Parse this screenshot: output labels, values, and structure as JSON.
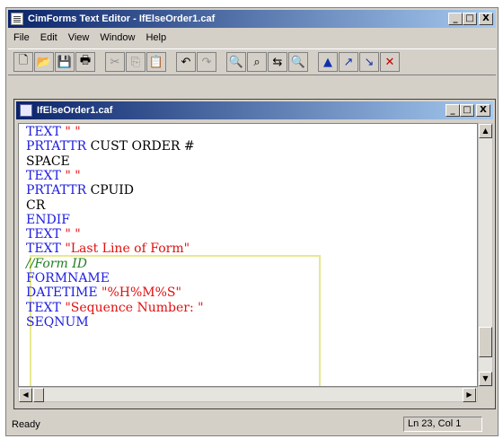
{
  "window": {
    "title": "CimForms Text Editor - IfElseOrder1.caf",
    "minimize_glyph": "_",
    "maximize_glyph": "□",
    "close_glyph": "X"
  },
  "menu": [
    {
      "label": "File"
    },
    {
      "label": "Edit"
    },
    {
      "label": "View"
    },
    {
      "label": "Window"
    },
    {
      "label": "Help"
    }
  ],
  "toolbar": [
    {
      "name": "new-icon",
      "glyph": "🗋"
    },
    {
      "name": "open-icon",
      "glyph": "📂"
    },
    {
      "name": "save-icon",
      "glyph": "💾"
    },
    {
      "name": "print-icon",
      "glyph": "🖶"
    },
    {
      "name": "cut-icon",
      "glyph": "✂"
    },
    {
      "name": "copy-icon",
      "glyph": "⎘"
    },
    {
      "name": "paste-icon",
      "glyph": "📋"
    },
    {
      "name": "undo-icon",
      "glyph": "↶"
    },
    {
      "name": "redo-icon",
      "glyph": "↷"
    },
    {
      "name": "find-icon",
      "glyph": "🔍"
    },
    {
      "name": "find-next-icon",
      "glyph": "⌕"
    },
    {
      "name": "replace-icon",
      "glyph": "⇆"
    },
    {
      "name": "find-red-icon",
      "glyph": "🔍"
    },
    {
      "name": "bookmark-icon",
      "glyph": "▲"
    },
    {
      "name": "bookmark-next-icon",
      "glyph": "↗"
    },
    {
      "name": "bookmark-prev-icon",
      "glyph": "↘"
    },
    {
      "name": "bookmark-clear-icon",
      "glyph": "✕"
    }
  ],
  "document": {
    "title": "IfElseOrder1.caf",
    "lines": [
      [
        {
          "c": "kw",
          "t": "TEXT "
        },
        {
          "c": "str",
          "t": "\" \""
        }
      ],
      [
        {
          "c": "kw",
          "t": "PRTATTR "
        },
        {
          "c": "plain",
          "t": "CUST ORDER #"
        }
      ],
      [
        {
          "c": "plain",
          "t": "SPACE"
        }
      ],
      [
        {
          "c": "kw",
          "t": "TEXT "
        },
        {
          "c": "str",
          "t": "\" \""
        }
      ],
      [
        {
          "c": "kw",
          "t": "PRTATTR "
        },
        {
          "c": "plain",
          "t": "CPUID"
        }
      ],
      [
        {
          "c": "plain",
          "t": "CR"
        }
      ],
      [
        {
          "c": "kw",
          "t": "ENDIF"
        }
      ],
      [
        {
          "c": "kw",
          "t": "TEXT "
        },
        {
          "c": "str",
          "t": "\" \""
        }
      ],
      [
        {
          "c": "kw",
          "t": "TEXT "
        },
        {
          "c": "str",
          "t": "\"Last Line of Form\""
        }
      ],
      [
        {
          "c": "comment",
          "t": "//Form ID"
        }
      ],
      [
        {
          "c": "kw",
          "t": "FORMNAME"
        }
      ],
      [
        {
          "c": "kw",
          "t": "DATETIME "
        },
        {
          "c": "str",
          "t": "\"%H%M%S\""
        }
      ],
      [
        {
          "c": "kw",
          "t": "TEXT "
        },
        {
          "c": "str",
          "t": "\"Sequence Number: \""
        }
      ],
      [
        {
          "c": "kw",
          "t": "SEQNUM"
        }
      ]
    ]
  },
  "status": {
    "text": "Ready",
    "position": "Ln 23, Col 1"
  }
}
